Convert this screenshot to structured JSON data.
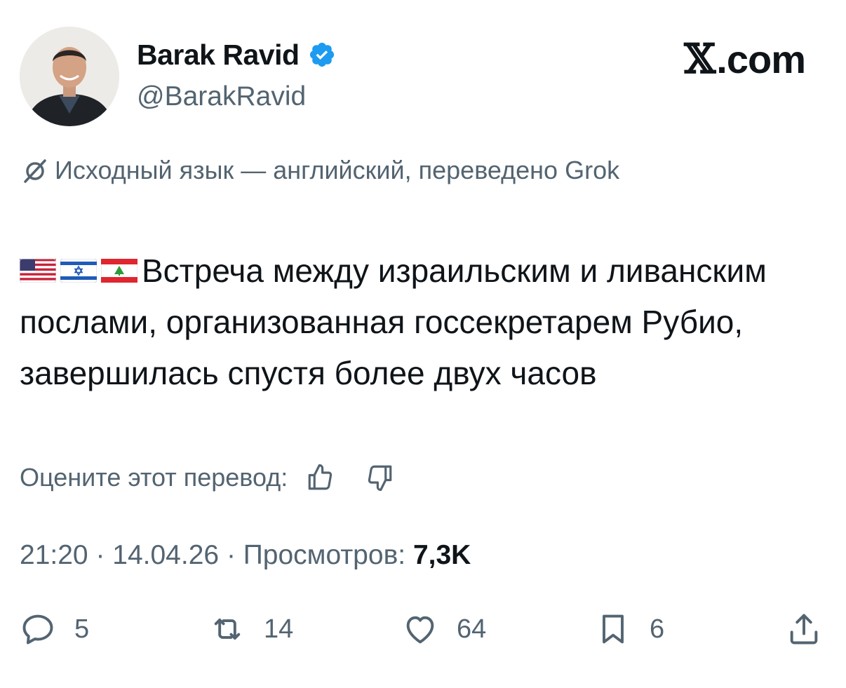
{
  "author": {
    "name": "Barak Ravid",
    "handle": "@BarakRavid"
  },
  "site_logo": {
    "prefix": "𝕏",
    "suffix": ".com"
  },
  "translation_notice": "Исходный язык — английский, переведено Grok",
  "tweet": {
    "flags": [
      "us-flag",
      "israel-flag",
      "lebanon-flag"
    ],
    "text": "Встреча между израильским и ливанским послами, организованная госсекретарем Рубио, завершилась спустя более двух часов"
  },
  "rate_translation": {
    "label": "Оцените этот перевод:"
  },
  "meta": {
    "time": "21:20",
    "date": "14.04.26",
    "views_label": "Просмотров:",
    "views_value": "7,3K"
  },
  "actions": {
    "replies": "5",
    "reposts": "14",
    "likes": "64",
    "bookmarks": "6"
  },
  "colors": {
    "text": "#0f1419",
    "secondary": "#536471",
    "verified": "#1d9bf0"
  }
}
